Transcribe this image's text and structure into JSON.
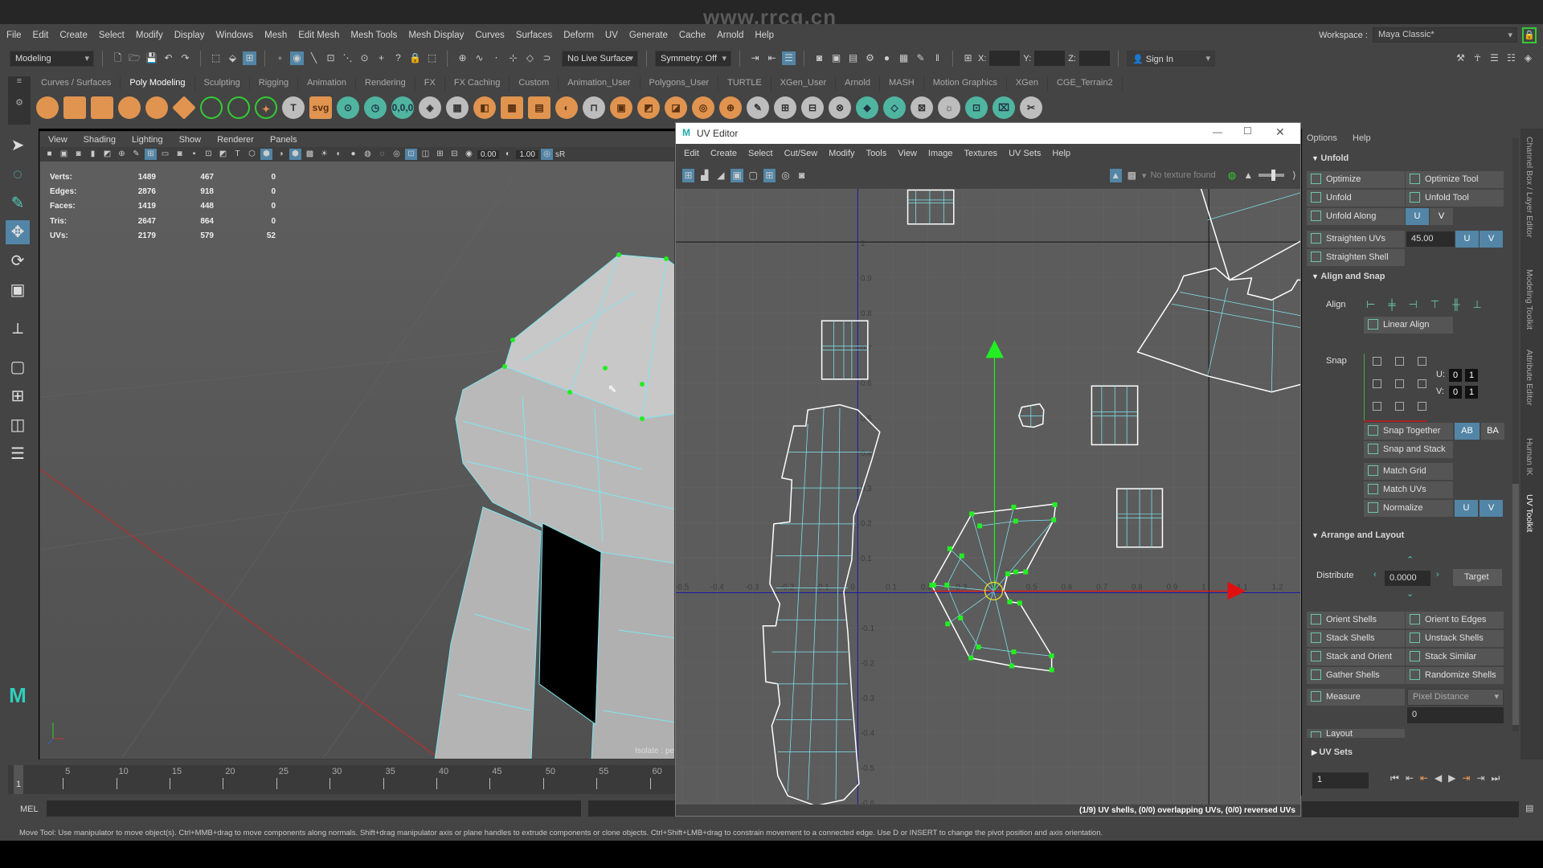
{
  "watermark": "www.rrcg.cn",
  "menubar": [
    "File",
    "Edit",
    "Create",
    "Select",
    "Modify",
    "Display",
    "Windows",
    "Mesh",
    "Edit Mesh",
    "Mesh Tools",
    "Mesh Display",
    "Curves",
    "Surfaces",
    "Deform",
    "UV",
    "Generate",
    "Cache",
    "Arnold",
    "Help"
  ],
  "workspace": {
    "label": "Workspace :",
    "value": "Maya Classic*"
  },
  "statusline": {
    "mode": "Modeling",
    "live_surface": "No Live Surface",
    "symmetry": "Symmetry: Off",
    "x": "X:",
    "y": "Y:",
    "z": "Z:",
    "sign_in": "Sign In"
  },
  "shelf": {
    "tabs": [
      "Curves / Surfaces",
      "Poly Modeling",
      "Sculpting",
      "Rigging",
      "Animation",
      "Rendering",
      "FX",
      "FX Caching",
      "Custom",
      "Animation_User",
      "Polygons_User",
      "TURTLE",
      "XGen_User",
      "Arnold",
      "MASH",
      "Motion Graphics",
      "XGen",
      "CGE_Terrain2"
    ],
    "active": 1,
    "icons": [
      [
        "poly-sphere-icon",
        ""
      ],
      [
        "poly-cube-icon",
        ""
      ],
      [
        "poly-cylinder-icon",
        ""
      ],
      [
        "poly-cone-icon",
        ""
      ],
      [
        "poly-torus-icon",
        ""
      ],
      [
        "poly-plane-icon",
        ""
      ],
      [
        "poly-disc-icon",
        ""
      ],
      [
        "platonic-solid-icon",
        ""
      ],
      [
        "super-shape-icon",
        "✦"
      ],
      [
        "poly-text-icon",
        "T"
      ],
      [
        "svg-icon",
        "svg"
      ],
      [
        "center-pivot-icon",
        "⊙"
      ],
      [
        "delete-history-icon",
        "◷"
      ],
      [
        "freeze-transform-icon",
        "0,0,0"
      ],
      [
        "combine-icon",
        "◈"
      ],
      [
        "separate-icon",
        "▦"
      ],
      [
        "mirror-icon",
        "◧"
      ],
      [
        "smooth-icon",
        "▩"
      ],
      [
        "extract-icon",
        "▤"
      ],
      [
        "boolean-icon",
        "◐"
      ],
      [
        "bridge-icon",
        "⊓"
      ],
      [
        "extrude-icon",
        "▣"
      ],
      [
        "bevel-icon",
        "◩"
      ],
      [
        "append-icon",
        "◪"
      ],
      [
        "fill-hole-icon",
        "◎"
      ],
      [
        "merge-icon",
        "⊕"
      ],
      [
        "multi-cut-icon",
        "✎"
      ],
      [
        "insert-edge-loop-icon",
        "⊞"
      ],
      [
        "offset-edge-loop-icon",
        "⊟"
      ],
      [
        "target-weld-icon",
        "⊗"
      ],
      [
        "quad-draw-icon",
        "◆"
      ],
      [
        "crease-icon",
        "◇"
      ],
      [
        "connect-icon",
        "⊠"
      ],
      [
        "sculpt-icon",
        "☼"
      ],
      [
        "uv-editor-icon",
        "⊡"
      ],
      [
        "uv-unfold-icon",
        "⌧"
      ],
      [
        "uv-cut-icon",
        "✂"
      ]
    ]
  },
  "viewport": {
    "menu": [
      "View",
      "Shading",
      "Lighting",
      "Show",
      "Renderer",
      "Panels"
    ],
    "field1": "0.00",
    "field2": "1.00",
    "srgb": "sR",
    "isolate": "Isolate : pe",
    "hud": [
      [
        "Verts:",
        "1489",
        "467",
        "0"
      ],
      [
        "Edges:",
        "2876",
        "918",
        "0"
      ],
      [
        "Faces:",
        "1419",
        "448",
        "0"
      ],
      [
        "Tris:",
        "2647",
        "864",
        "0"
      ],
      [
        "UVs:",
        "2179",
        "579",
        "52"
      ]
    ]
  },
  "timeline": {
    "ticks": [
      5,
      10,
      15,
      20,
      25,
      30,
      35,
      40,
      45,
      50,
      55,
      60
    ],
    "current": "1",
    "range_field": "1"
  },
  "mel": {
    "label": "MEL"
  },
  "help_line": "Move Tool: Use manipulator to move object(s). Ctrl+MMB+drag to move components along normals. Shift+drag manipulator axis or plane handles to extrude components or clone objects. Ctrl+Shift+LMB+drag to constrain movement to a connected edge. Use D or INSERT to change the pivot position and axis orientation.",
  "uv_editor": {
    "title": "UV Editor",
    "menu": [
      "Edit",
      "Create",
      "Select",
      "Cut/Sew",
      "Modify",
      "Tools",
      "View",
      "Image",
      "Textures",
      "UV Sets",
      "Help"
    ],
    "texture_status": "No texture found",
    "status": "(1/9) UV shells, (0/0) overlapping UVs, (0/0) reversed UVs",
    "u_ticks": [
      "-0.5",
      "-0.4",
      "-0.3",
      "-0.2",
      "-0.1",
      "0",
      "0.1",
      "0.2",
      "0.3",
      "0.4",
      "0.5",
      "0.6",
      "0.7",
      "0.8",
      "0.9",
      "1",
      "1.1",
      "1.2"
    ],
    "v_ticks": [
      "1",
      "0.9",
      "0.8",
      "0.7",
      "0.6",
      "0.5",
      "0.4",
      "0.3",
      "0.2",
      "0.1",
      "-0.1",
      "-0.2",
      "-0.3",
      "-0.4",
      "-0.5",
      "-0.6"
    ]
  },
  "uv_toolkit": {
    "options": "Options",
    "help": "Help",
    "unfold": {
      "header": "Unfold",
      "optimize": "Optimize",
      "optimize_tool": "Optimize Tool",
      "unfold": "Unfold",
      "unfold_tool": "Unfold Tool",
      "unfold_along": "Unfold Along",
      "straighten_uvs": "Straighten UVs",
      "angle": "45.00",
      "straighten_shell": "Straighten Shell",
      "u": "U",
      "v": "V"
    },
    "align_snap": {
      "header": "Align and Snap",
      "align": "Align",
      "linear_align": "Linear Align",
      "snap": "Snap",
      "u_label": "U:",
      "v_label": "V:",
      "u_min": "0",
      "u_max": "1",
      "v_min": "0",
      "v_max": "1",
      "snap_together": "Snap Together",
      "ab": "AB",
      "ba": "BA",
      "snap_and_stack": "Snap and Stack",
      "match_grid": "Match Grid",
      "match_uvs": "Match UVs",
      "normalize": "Normalize"
    },
    "arrange": {
      "header": "Arrange and Layout",
      "distribute": "Distribute",
      "distribute_value": "0.0000",
      "target": "Target",
      "orient_shells": "Orient Shells",
      "orient_to_edges": "Orient to Edges",
      "stack_shells": "Stack Shells",
      "unstack_shells": "Unstack Shells",
      "stack_and_orient": "Stack and Orient",
      "stack_similar": "Stack Similar",
      "gather_shells": "Gather Shells",
      "randomize_shells": "Randomize Shells",
      "measure": "Measure",
      "measure_mode": "Pixel Distance",
      "measure_value": "0",
      "layout": "Layout"
    },
    "uv_sets": "UV Sets"
  },
  "side_tabs": [
    "Channel Box / Layer Editor",
    "Modeling Toolkit",
    "Attribute Editor",
    "Human IK",
    "UV Toolkit"
  ],
  "colors": {
    "accent": "#5285a6",
    "uv_edge": "#7fe6f0",
    "selected": "#22ee22",
    "u_axis": "#e01010",
    "v_axis": "#22ee22"
  }
}
